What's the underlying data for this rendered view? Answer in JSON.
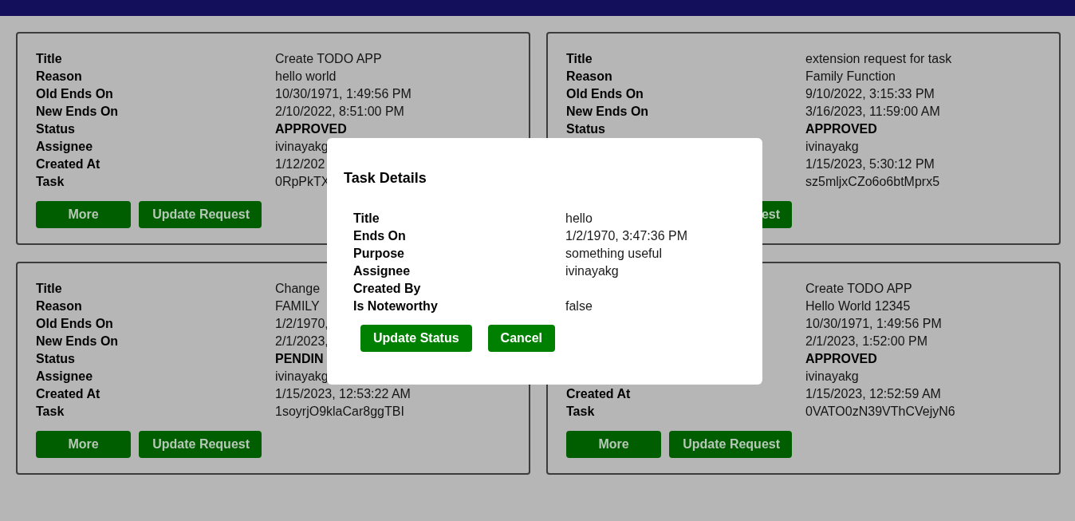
{
  "cards": [
    {
      "rows": [
        {
          "kind": "field",
          "label": "Title",
          "value": "Create TODO APP"
        },
        {
          "kind": "field",
          "label": "Reason",
          "value": "hello world"
        },
        {
          "kind": "field",
          "label": "Old Ends On",
          "value": "10/30/1971, 1:49:56 PM"
        },
        {
          "kind": "field",
          "label": "New Ends On",
          "value": "2/10/2022, 8:51:00 PM"
        },
        {
          "kind": "status",
          "label": "Status",
          "value": "APPROVED"
        },
        {
          "kind": "field",
          "label": "Assignee",
          "value": "ivinayakg"
        },
        {
          "kind": "field",
          "label": "Created At",
          "value": "1/12/202"
        },
        {
          "kind": "field",
          "label": "Task",
          "value": "0RpPkTX"
        }
      ],
      "buttons": [
        {
          "kind": "more",
          "label": "More"
        },
        {
          "kind": "update",
          "label": "Update Request"
        }
      ]
    },
    {
      "rows": [
        {
          "kind": "field",
          "label": "Title",
          "value": "extension request for task"
        },
        {
          "kind": "field",
          "label": "Reason",
          "value": "Family Function"
        },
        {
          "kind": "field",
          "label": "Old Ends On",
          "value": "9/10/2022, 3:15:33 PM"
        },
        {
          "kind": "field",
          "label": "New Ends On",
          "value": "3/16/2023, 11:59:00 AM"
        },
        {
          "kind": "status",
          "label": "Status",
          "value": "APPROVED"
        },
        {
          "kind": "field",
          "value": "ivinayakg"
        },
        {
          "kind": "field",
          "value": "1/15/2023, 5:30:12 PM"
        },
        {
          "kind": "field",
          "value": "sz5mljxCZo6o6btMprx5"
        }
      ],
      "buttons": [
        {
          "kind": "more"
        },
        {
          "kind": "update",
          "label": "est"
        }
      ]
    },
    {
      "rows": [
        {
          "kind": "field",
          "label": "Title",
          "value": "Change"
        },
        {
          "kind": "field",
          "label": "Reason",
          "value": "FAMILY"
        },
        {
          "kind": "field",
          "label": "Old Ends On",
          "value": "1/2/1970,"
        },
        {
          "kind": "field",
          "label": "New Ends On",
          "value": "2/1/2023,"
        },
        {
          "kind": "status",
          "label": "Status",
          "value": "PENDIN"
        },
        {
          "kind": "field",
          "label": "Assignee",
          "value": "ivinayakg"
        },
        {
          "kind": "field",
          "label": "Created At",
          "value": "1/15/2023, 12:53:22 AM"
        },
        {
          "kind": "field",
          "label": "Task",
          "value": "1soyrjO9klaCar8ggTBI"
        }
      ],
      "buttons": [
        {
          "kind": "more",
          "label": "More"
        },
        {
          "kind": "update",
          "label": "Update Request"
        }
      ]
    },
    {
      "rows": [
        {
          "kind": "field",
          "value": "Create TODO APP"
        },
        {
          "kind": "field",
          "value": "Hello World 12345"
        },
        {
          "kind": "field",
          "value": "10/30/1971, 1:49:56 PM"
        },
        {
          "kind": "field",
          "value": "2/1/2023, 1:52:00 PM"
        },
        {
          "kind": "status",
          "value": "APPROVED"
        },
        {
          "kind": "field",
          "value": "ivinayakg"
        },
        {
          "kind": "field",
          "label": "Created At",
          "value": "1/15/2023, 12:52:59 AM"
        },
        {
          "kind": "field",
          "label": "Task",
          "value": "0VATO0zN39VThCVejyN6"
        }
      ],
      "buttons": [
        {
          "kind": "more",
          "label": "More"
        },
        {
          "kind": "update",
          "label": "Update Request"
        }
      ]
    }
  ],
  "modal": {
    "title": "Task Details",
    "rows": [
      {
        "label": "Title",
        "value": "hello"
      },
      {
        "label": "Ends On",
        "value": "1/2/1970, 3:47:36 PM"
      },
      {
        "label": "Purpose",
        "value": "something useful"
      },
      {
        "label": "Assignee",
        "value": "ivinayakg"
      },
      {
        "label": "Created By"
      },
      {
        "label": "Is Noteworthy",
        "value": "false"
      }
    ],
    "buttons": [
      "Update Status",
      "Cancel"
    ]
  }
}
